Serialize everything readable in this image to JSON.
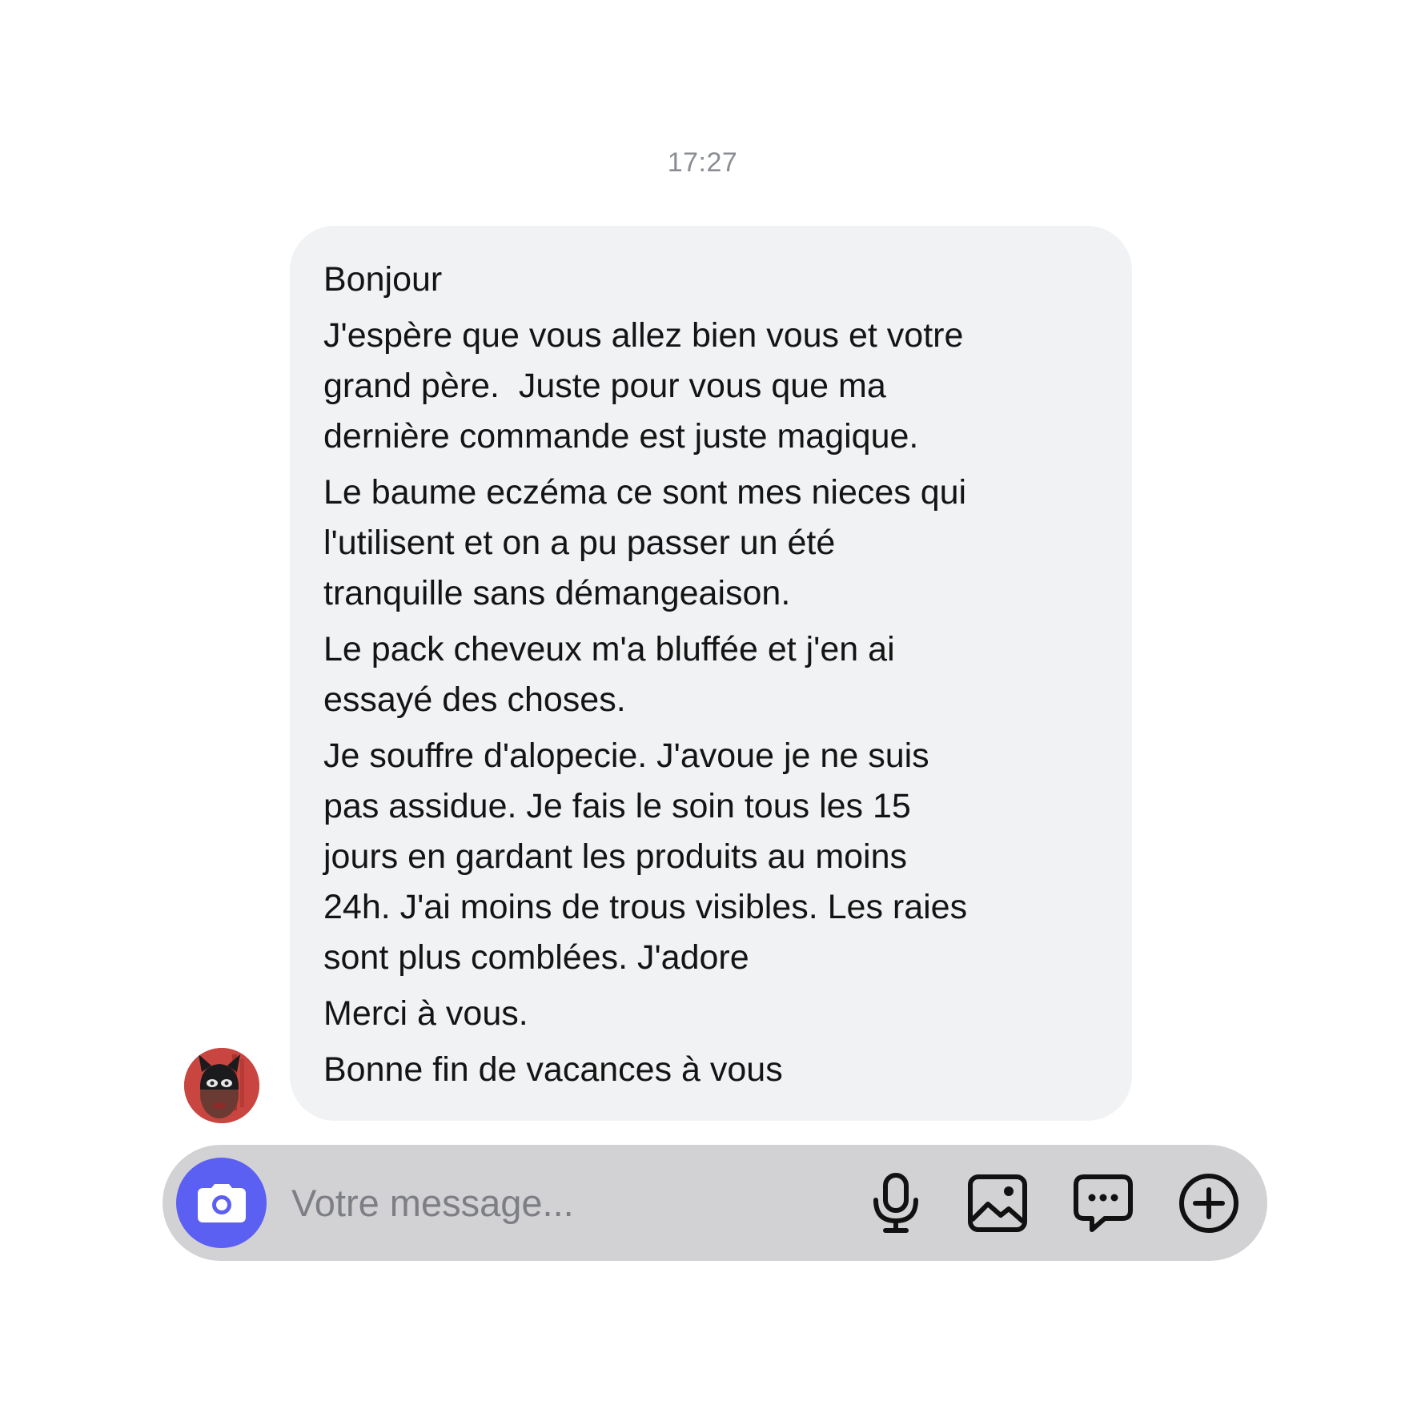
{
  "chat": {
    "timestamp": "17:27",
    "message": {
      "paragraphs": [
        "Bonjour",
        "J'espère que vous allez bien vous et votre\ngrand père.  Juste pour vous que ma\ndernière commande est juste magique.",
        "Le baume eczéma ce sont mes nieces qui\nl'utilisent et on a pu passer un été\ntranquille sans démangeaison.",
        "Le pack cheveux m'a bluffée et j'en ai\nessayé des choses.",
        "Je souffre d'alopecie. J'avoue je ne suis\npas assidue. Je fais le soin tous les 15\njours en gardant les produits au moins\n24h. J'ai moins de trous visibles. Les raies\nsont plus comblées. J'adore",
        "Merci à vous.",
        "Bonne fin de vacances à vous"
      ]
    }
  },
  "composer": {
    "placeholder": "Votre message...",
    "icons": [
      "camera-icon",
      "microphone-icon",
      "image-icon",
      "chat-bubble-icon",
      "plus-circle-icon"
    ]
  },
  "colors": {
    "accent": "#5b5ff2",
    "bubble": "#f1f2f4",
    "composer": "#d2d2d4",
    "timestamp": "#8a8d91",
    "text": "#141414",
    "placeholder": "#7d7f85"
  }
}
